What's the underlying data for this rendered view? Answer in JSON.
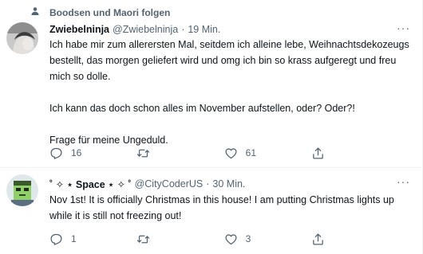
{
  "social_context": {
    "text": "Boodsen und Maori folgen"
  },
  "tweets": [
    {
      "display_name": "Zwiebelninja",
      "handle": "@Zwiebelninja",
      "time": "19 Min.",
      "paragraphs": [
        "Ich habe mir zum allerersten Mal, seitdem ich alleine lebe, Weihnachtsdekozeugs bestellt, das morgen geliefert wird und omg ich bin so krass aufgeregt und freu mich so dolle.",
        "Ich kann das doch schon alles im November aufstellen, oder? Oder?!",
        "Frage für meine Ungeduld."
      ],
      "actions": {
        "replies": "16",
        "retweets": "",
        "likes": "61"
      }
    },
    {
      "display_name": "˚ ✧ ⋆ Space ⋆ ✧ ˚",
      "handle": "@CityCoderUS",
      "time": "30 Min.",
      "paragraphs": [
        "Nov 1st! It is officially Christmas in this house! I am putting Christmas lights up while it is still not freezing out!"
      ],
      "actions": {
        "replies": "1",
        "retweets": "",
        "likes": "3"
      }
    }
  ],
  "separator": "·",
  "more_label": "···",
  "icons": [
    "person-icon",
    "reply-icon",
    "retweet-icon",
    "like-icon",
    "share-icon"
  ],
  "colors": {
    "text": "#0f1419",
    "secondary": "#536471",
    "border": "#eff3f4"
  }
}
